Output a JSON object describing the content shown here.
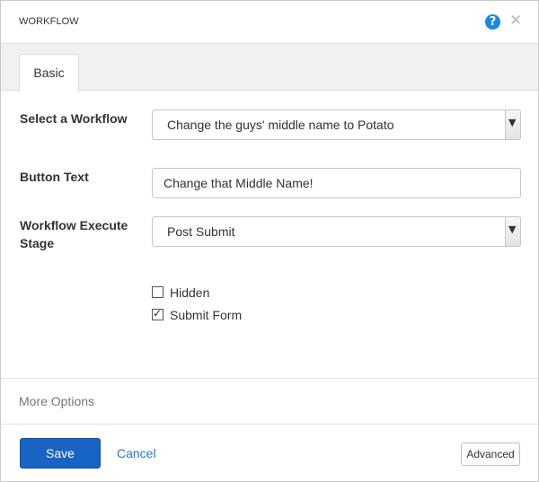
{
  "dialog": {
    "title": "WORKFLOW",
    "help_icon": "question-circle-icon",
    "close_icon": "close-icon"
  },
  "tabs": [
    {
      "label": "Basic",
      "active": true
    }
  ],
  "form": {
    "workflow": {
      "label": "Select a Workflow",
      "value": "Change the guys' middle name to Potato"
    },
    "button_text": {
      "label": "Button Text",
      "value": "Change that Middle Name!"
    },
    "execute_stage": {
      "label": "Workflow Execute Stage",
      "value": "Post Submit"
    },
    "checkboxes": [
      {
        "label": "Hidden",
        "checked": false
      },
      {
        "label": "Submit Form",
        "checked": true
      }
    ]
  },
  "more_options": "More Options",
  "footer": {
    "save_label": "Save",
    "cancel_label": "Cancel",
    "advanced_label": "Advanced"
  },
  "colors": {
    "primary": "#1864c4",
    "link": "#2a74c8",
    "help": "#1e88e5"
  }
}
